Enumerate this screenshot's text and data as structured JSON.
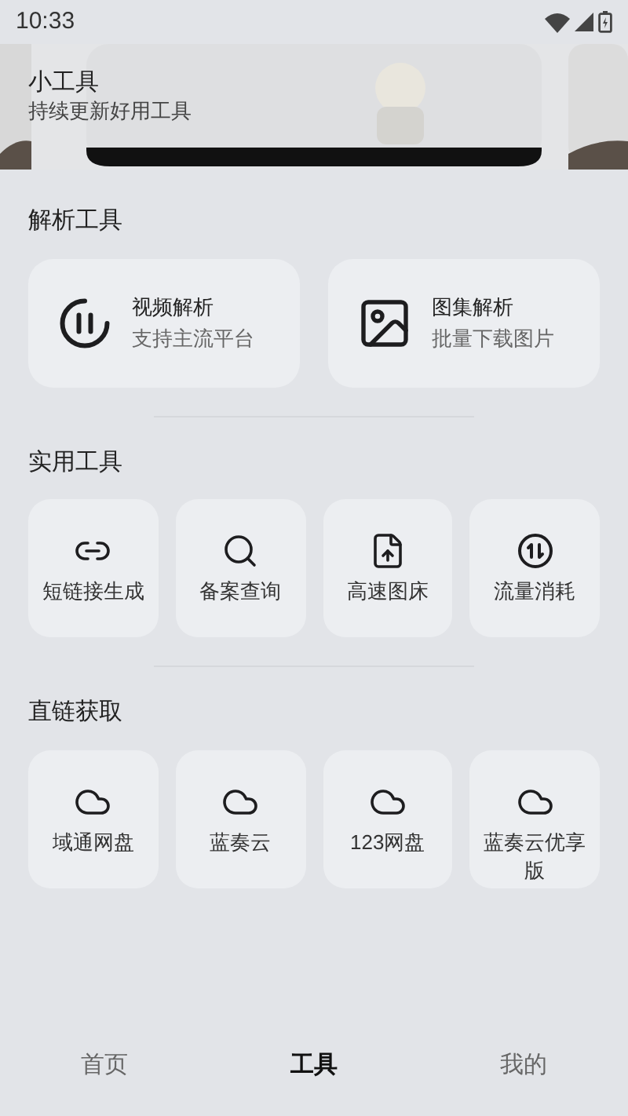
{
  "status_bar": {
    "time": "10:33"
  },
  "header": {
    "title": "小工具",
    "subtitle": "持续更新好用工具"
  },
  "sections": [
    {
      "title": "解析工具",
      "items": [
        {
          "title": "视频解析",
          "subtitle": "支持主流平台"
        },
        {
          "title": "图集解析",
          "subtitle": "批量下载图片"
        }
      ]
    },
    {
      "title": "实用工具",
      "items": [
        {
          "title": "短链接生成"
        },
        {
          "title": "备案查询"
        },
        {
          "title": "高速图床"
        },
        {
          "title": "流量消耗"
        }
      ]
    },
    {
      "title": "直链获取",
      "items": [
        {
          "title": "域通网盘"
        },
        {
          "title": "蓝奏云"
        },
        {
          "title": "123网盘"
        },
        {
          "title": "蓝奏云优享版"
        }
      ]
    }
  ],
  "bottom_nav": [
    {
      "label": "首页",
      "selected": false
    },
    {
      "label": "工具",
      "selected": true
    },
    {
      "label": "我的",
      "selected": false
    }
  ]
}
